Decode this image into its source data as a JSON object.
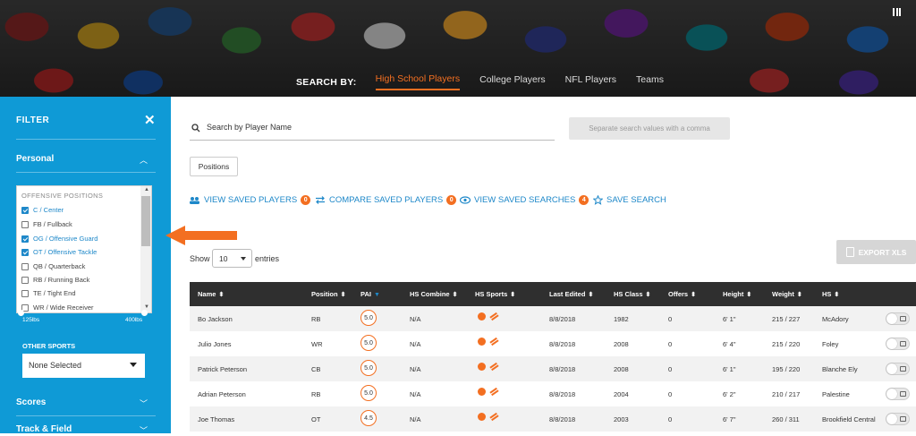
{
  "hero": {
    "search_by": "SEARCH BY:",
    "tabs": [
      "High School Players",
      "College Players",
      "NFL Players",
      "Teams"
    ],
    "active_tab": "High School Players"
  },
  "sidebar": {
    "title": "FILTER",
    "sections": {
      "personal": "Personal",
      "scores": "Scores",
      "track_field": "Track & Field"
    },
    "positions_title": "OFFENSIVE POSITIONS",
    "positions": [
      {
        "label": "C / Center",
        "checked": true
      },
      {
        "label": "FB / Fullback",
        "checked": false
      },
      {
        "label": "OG / Offensive Guard",
        "checked": true
      },
      {
        "label": "OT / Offensive Tackle",
        "checked": true
      },
      {
        "label": "QB / Quarterback",
        "checked": false
      },
      {
        "label": "RB / Running Back",
        "checked": false
      },
      {
        "label": "TE / Tight End",
        "checked": false
      },
      {
        "label": "WR / Wide Receiver",
        "checked": false
      }
    ],
    "weight_min": "125lbs",
    "weight_max": "400lbs",
    "other_sports_label": "OTHER SPORTS",
    "other_sports_value": "None Selected"
  },
  "main": {
    "search_placeholder": "Search by Player Name",
    "separate_placeholder": "Separate search values with a comma",
    "positions_button": "Positions",
    "actions": [
      {
        "label": "VIEW SAVED PLAYERS",
        "count": "0"
      },
      {
        "label": "COMPARE SAVED PLAYERS",
        "count": "0"
      },
      {
        "label": "VIEW SAVED SEARCHES",
        "count": "4"
      },
      {
        "label": "SAVE SEARCH",
        "count": null
      }
    ],
    "export_label": "EXPORT XLS",
    "show_label": "Show",
    "entries_label": "entries",
    "page_length": "10"
  },
  "table": {
    "columns": [
      "Name",
      "Position",
      "PAI",
      "HS Combine",
      "HS Sports",
      "Last Edited",
      "HS Class",
      "Offers",
      "Height",
      "Weight",
      "HS"
    ],
    "rows": [
      {
        "name": "Bo Jackson",
        "position": "RB",
        "pai": "5.0",
        "combine": "N/A",
        "edited": "8/8/2018",
        "class": "1982",
        "offers": "0",
        "height": "6' 1\"",
        "weight": "215 / 227",
        "hs": "McAdory"
      },
      {
        "name": "Julio Jones",
        "position": "WR",
        "pai": "5.0",
        "combine": "N/A",
        "edited": "8/8/2018",
        "class": "2008",
        "offers": "0",
        "height": "6' 4\"",
        "weight": "215 / 220",
        "hs": "Foley"
      },
      {
        "name": "Patrick Peterson",
        "position": "CB",
        "pai": "5.0",
        "combine": "N/A",
        "edited": "8/8/2018",
        "class": "2008",
        "offers": "0",
        "height": "6' 1\"",
        "weight": "195 / 220",
        "hs": "Blanche Ely"
      },
      {
        "name": "Adrian Peterson",
        "position": "RB",
        "pai": "5.0",
        "combine": "N/A",
        "edited": "8/8/2018",
        "class": "2004",
        "offers": "0",
        "height": "6' 2\"",
        "weight": "210 / 217",
        "hs": "Palestine"
      },
      {
        "name": "Joe Thomas",
        "position": "OT",
        "pai": "4.5",
        "combine": "N/A",
        "edited": "8/8/2018",
        "class": "2003",
        "offers": "0",
        "height": "6' 7\"",
        "weight": "260 / 311",
        "hs": "Brookfield Central"
      }
    ]
  },
  "colors": {
    "sidebar": "#0f9ad6",
    "accent_orange": "#f36f21",
    "link_blue": "#1e88c9",
    "table_header": "#2f2f2f"
  }
}
